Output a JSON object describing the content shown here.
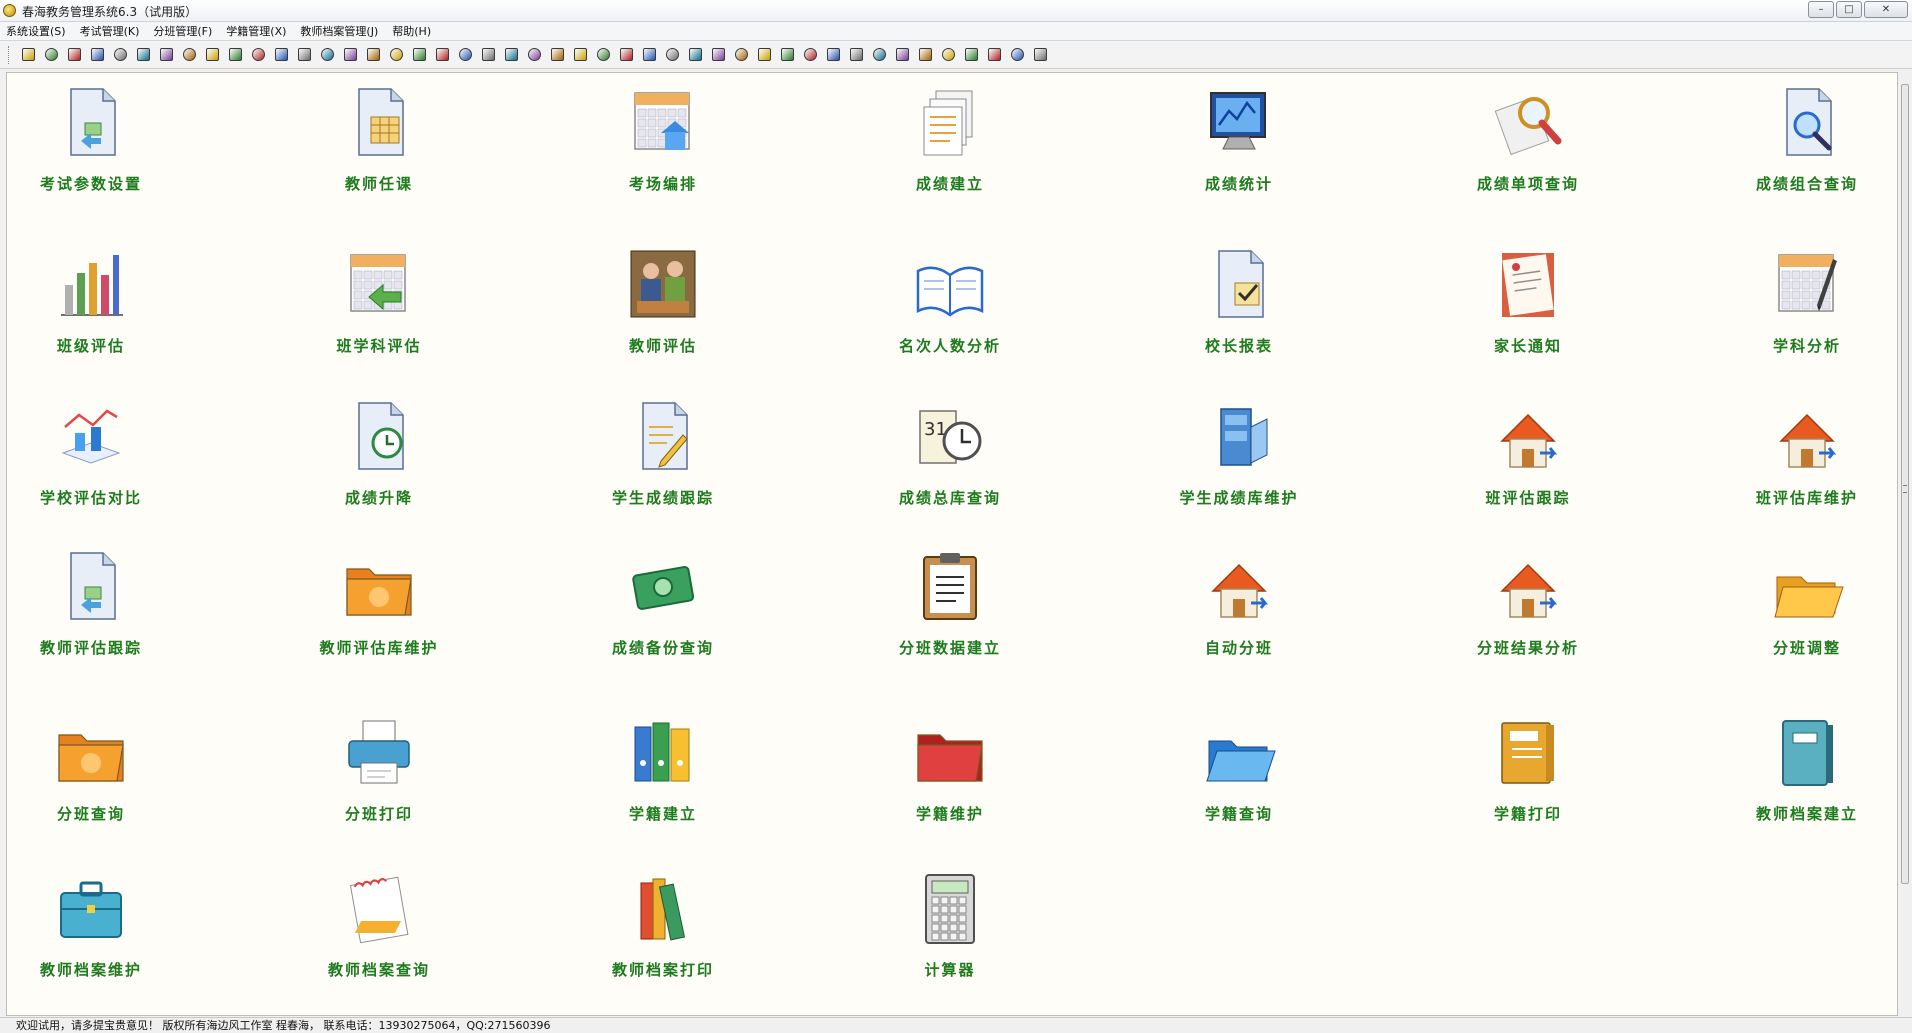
{
  "window": {
    "title": "春海教务管理系统6.3（试用版）",
    "buttons": {
      "minimize": "–",
      "maximize": "□",
      "close": "✕"
    }
  },
  "menu": [
    "系统设置(S)",
    "考试管理(K)",
    "分班管理(F)",
    "学籍管理(X)",
    "教师档案管理(J)",
    "帮助(H)"
  ],
  "toolbar_icon_count": 45,
  "tiles": [
    {
      "label": "考试参数设置",
      "icon": "document-arrow-icon"
    },
    {
      "label": "教师任课",
      "icon": "document-calendar-icon"
    },
    {
      "label": "考场编排",
      "icon": "calendar-house-icon"
    },
    {
      "label": "成绩建立",
      "icon": "documents-stack-icon"
    },
    {
      "label": "成绩统计",
      "icon": "monitor-chart-icon"
    },
    {
      "label": "成绩单项查询",
      "icon": "magnifier-icon"
    },
    {
      "label": "成绩组合查询",
      "icon": "document-magnifier-icon"
    },
    {
      "label": "班级评估",
      "icon": "bar-chart-icon"
    },
    {
      "label": "班学科评估",
      "icon": "calendar-arrow-icon"
    },
    {
      "label": "教师评估",
      "icon": "meeting-people-icon"
    },
    {
      "label": "名次人数分析",
      "icon": "open-book-icon"
    },
    {
      "label": "校长报表",
      "icon": "document-check-icon"
    },
    {
      "label": "家长通知",
      "icon": "letter-icon"
    },
    {
      "label": "学科分析",
      "icon": "calendar-pen-icon"
    },
    {
      "label": "学校评估对比",
      "icon": "line-chart-icon"
    },
    {
      "label": "成绩升降",
      "icon": "document-clock-icon"
    },
    {
      "label": "学生成绩跟踪",
      "icon": "document-pencil-icon"
    },
    {
      "label": "成绩总库查询",
      "icon": "calendar-clock-icon"
    },
    {
      "label": "学生成绩库维护",
      "icon": "database-icon"
    },
    {
      "label": "班评估跟踪",
      "icon": "house-arrow-icon"
    },
    {
      "label": "班评估库维护",
      "icon": "house-arrow-icon"
    },
    {
      "label": "教师评估跟踪",
      "icon": "document-arrow-icon"
    },
    {
      "label": "教师评估库维护",
      "icon": "orange-folder-icon"
    },
    {
      "label": "成绩备份查询",
      "icon": "money-icon"
    },
    {
      "label": "分班数据建立",
      "icon": "clipboard-icon"
    },
    {
      "label": "自动分班",
      "icon": "house-arrow-icon"
    },
    {
      "label": "分班结果分析",
      "icon": "house-arrow-icon"
    },
    {
      "label": "分班调整",
      "icon": "open-folder-icon"
    },
    {
      "label": "分班查询",
      "icon": "orange-folder-icon"
    },
    {
      "label": "分班打印",
      "icon": "printer-icon"
    },
    {
      "label": "学籍建立",
      "icon": "binders-icon"
    },
    {
      "label": "学籍维护",
      "icon": "red-folder-icon"
    },
    {
      "label": "学籍查询",
      "icon": "blue-folder-icon"
    },
    {
      "label": "学籍打印",
      "icon": "file-folder-icon"
    },
    {
      "label": "教师档案建立",
      "icon": "notebook-icon"
    },
    {
      "label": "教师档案维护",
      "icon": "briefcase-icon"
    },
    {
      "label": "教师档案查询",
      "icon": "notepad-icon"
    },
    {
      "label": "教师档案打印",
      "icon": "books-icon"
    },
    {
      "label": "计算器",
      "icon": "calculator-icon"
    }
  ],
  "status": "欢迎试用，请多提宝贵意见！ 版权所有海边风工作室 程春海， 联系电话：13930275064，QQ:271560396"
}
